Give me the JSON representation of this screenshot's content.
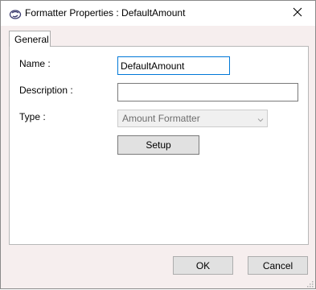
{
  "window": {
    "title": "Formatter Properties : DefaultAmount",
    "app_icon": "formatter-app-icon",
    "close_icon": "close-icon"
  },
  "tabs": [
    {
      "label": "General",
      "selected": true
    }
  ],
  "form": {
    "name_label": "Name :",
    "name_value": "DefaultAmount",
    "description_label": "Description :",
    "description_value": "",
    "type_label": "Type :",
    "type_value": "Amount Formatter",
    "type_chevron_icon": "chevron-down-icon",
    "setup_label": "Setup"
  },
  "footer": {
    "ok_label": "OK",
    "cancel_label": "Cancel"
  }
}
